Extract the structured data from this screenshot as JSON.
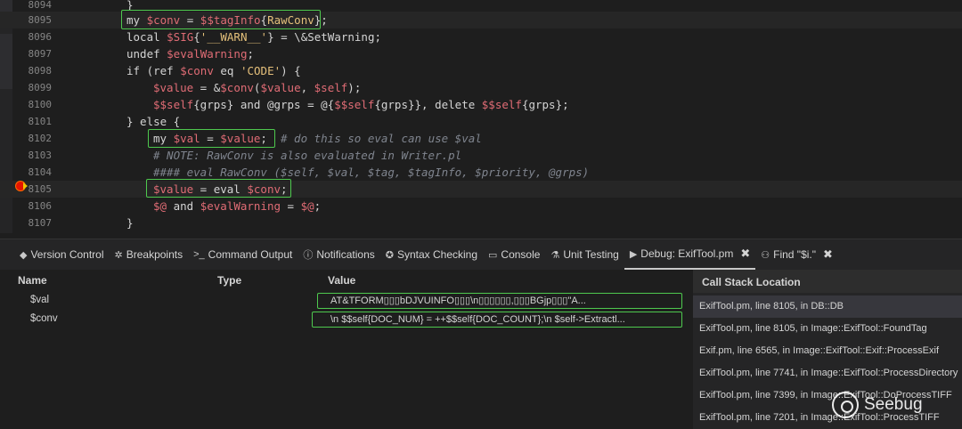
{
  "editor": {
    "lines": [
      {
        "n": "8094",
        "code": "}"
      },
      {
        "n": "8095",
        "code": "my $conv = $$tagInfo{RawConv};"
      },
      {
        "n": "8096",
        "code": "local $SIG{'__WARN__'} = \\&SetWarning;"
      },
      {
        "n": "8097",
        "code": "undef $evalWarning;"
      },
      {
        "n": "8098",
        "code": "if (ref $conv eq 'CODE') {"
      },
      {
        "n": "8099",
        "code": "$value = &$conv($value, $self);"
      },
      {
        "n": "8100",
        "code": "$$self{grps} and @grps = @{$$self{grps}}, delete $$self{grps};"
      },
      {
        "n": "8101",
        "code": "} else {"
      },
      {
        "n": "8102",
        "code": "my $val = $value;  # do this so eval can use $val"
      },
      {
        "n": "8103",
        "code": "# NOTE: RawConv is also evaluated in Writer.pl"
      },
      {
        "n": "8104",
        "code": "#### eval RawConv ($self, $val, $tag, $tagInfo, $priority, @grps)"
      },
      {
        "n": "8105",
        "code": "$value = eval $conv;"
      },
      {
        "n": "8106",
        "code": "$@ and $evalWarning = $@;"
      },
      {
        "n": "8107",
        "code": "}"
      }
    ]
  },
  "tabs": [
    {
      "label": "Version Control",
      "icon": "version-control-icon"
    },
    {
      "label": "Breakpoints",
      "icon": "bug-icon"
    },
    {
      "label": "Command Output",
      "icon": "terminal-icon"
    },
    {
      "label": "Notifications",
      "icon": "info-icon"
    },
    {
      "label": "Syntax Checking",
      "icon": "syntax-check-icon"
    },
    {
      "label": "Console",
      "icon": "console-icon"
    },
    {
      "label": "Unit Testing",
      "icon": "flask-icon"
    },
    {
      "label": "Debug: ExifTool.pm",
      "icon": "play-icon",
      "active": true,
      "closable": true
    },
    {
      "label": "Find \"$i.\"",
      "icon": "binoculars-icon",
      "closable": true
    }
  ],
  "variables": {
    "headers": {
      "name": "Name",
      "type": "Type",
      "value": "Value"
    },
    "rows": [
      {
        "name": "$val",
        "type": "",
        "value": "AT&TFORM▯▯▯bDJVUINFO▯▯▯\\n▯▯▯▯▯▯,▯▯▯BGjp▯▯▯\"A..."
      },
      {
        "name": "$conv",
        "type": "",
        "value": "\\n          $$self{DOC_NUM} = ++$$self{DOC_COUNT};\\n          $self->Extractl..."
      }
    ]
  },
  "call_stack": {
    "header": "Call Stack Location",
    "rows": [
      "ExifTool.pm, line 8105, in DB::DB",
      "ExifTool.pm, line 8105, in Image::ExifTool::FoundTag",
      "Exif.pm, line 6565, in Image::ExifTool::Exif::ProcessExif",
      "ExifTool.pm, line 7741, in Image::ExifTool::ProcessDirectory",
      "ExifTool.pm, line 7399, in Image::ExifTool::DoProcessTIFF",
      "ExifTool.pm, line 7201, in Image::ExifTool::ProcessTIFF"
    ]
  },
  "watermark": "Seebug",
  "colors": {
    "highlight_box": "#4ec94e",
    "breakpoint": "#e51400",
    "variable": "#e06c75",
    "string": "#e5c07b",
    "comment": "#7f848e"
  }
}
